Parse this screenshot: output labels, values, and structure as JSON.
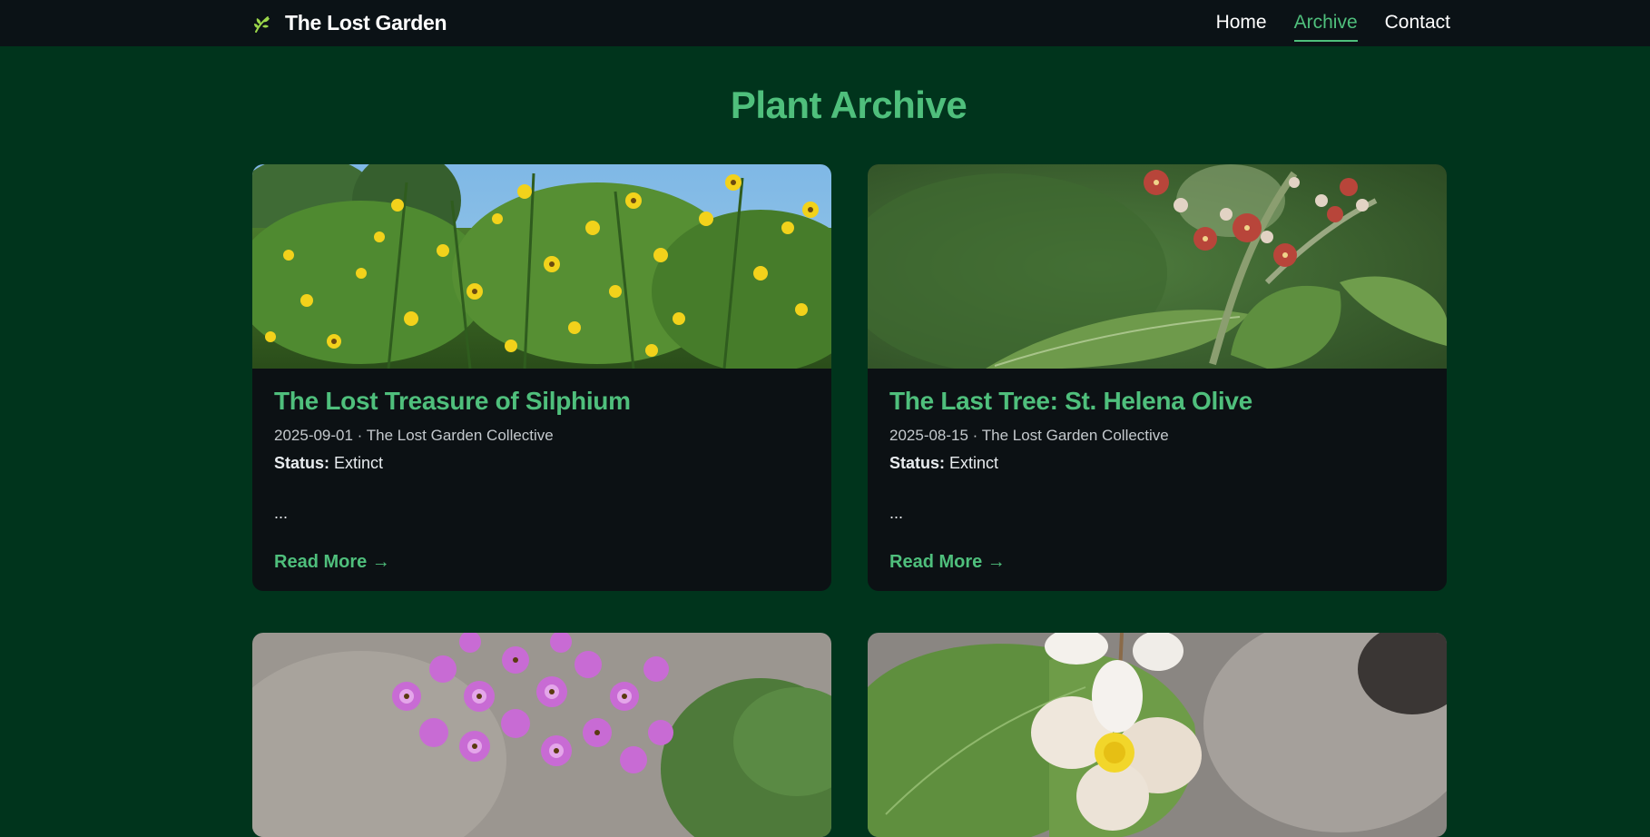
{
  "site": {
    "brand": "The Lost Garden",
    "icon": "leaf-sprout-icon"
  },
  "nav": {
    "home": "Home",
    "archive": "Archive",
    "contact": "Contact",
    "active": "Archive",
    "accent_color": "#4fbf7c"
  },
  "page": {
    "title": "Plant Archive",
    "background_color": "#00341c"
  },
  "cards": [
    {
      "title": "The Lost Treasure of Silphium",
      "meta": "2025-09-01 · The Lost Garden Collective",
      "status_label": "Status:",
      "status_value": "Extinct",
      "excerpt": "...",
      "read_more": "Read More →",
      "image": "yellow-wildflowers-photo"
    },
    {
      "title": "The Last Tree: St. Helena Olive",
      "meta": "2025-08-15 · The Lost Garden Collective",
      "status_label": "Status:",
      "status_value": "Extinct",
      "excerpt": "...",
      "read_more": "Read More →",
      "image": "red-blossom-leaves-photo"
    },
    {
      "image": "pink-star-flowers-photo"
    },
    {
      "image": "white-begonia-flower-photo"
    }
  ]
}
